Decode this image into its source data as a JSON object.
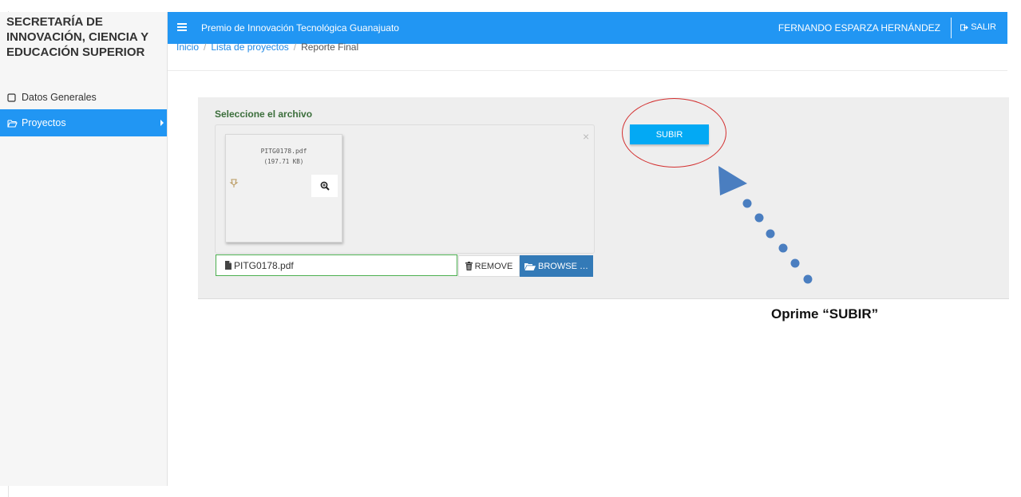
{
  "sidebar": {
    "brand": [
      "SECRETARÍA DE",
      "INNOVACIÓN, CIENCIA Y",
      "EDUCACIÓN SUPERIOR"
    ],
    "items": [
      {
        "label": "Datos Generales",
        "icon": "square-icon",
        "active": false
      },
      {
        "label": "Proyectos",
        "icon": "folder-open-icon",
        "active": true
      }
    ]
  },
  "topbar": {
    "title": "Premio de Innovación Tecnológica Guanajuato",
    "user": "FERNANDO ESPARZA HERNÁNDEZ",
    "logout_label": "SALIR"
  },
  "breadcrumb": {
    "items": [
      "Inicio",
      "Lista de proyectos",
      "Reporte Final"
    ]
  },
  "upload": {
    "label": "Seleccione el archivo",
    "close_glyph": "×",
    "preview_file_name": "PITG0178.pdf",
    "preview_file_size": "(197.71 KB)",
    "input_value": "PITG0178.pdf",
    "remove_label": "REMOVE",
    "browse_label": "BROWSE …",
    "submit_label": "SUBIR"
  },
  "annotation": {
    "note": "Oprime “SUBIR”",
    "ellipse_color": "#d32f2f",
    "arrow_color": "#4a7ec0"
  },
  "colors": {
    "primary": "#2196f3",
    "submit": "#03a9f4",
    "browse": "#337ab7",
    "input_border": "#4caf50"
  }
}
